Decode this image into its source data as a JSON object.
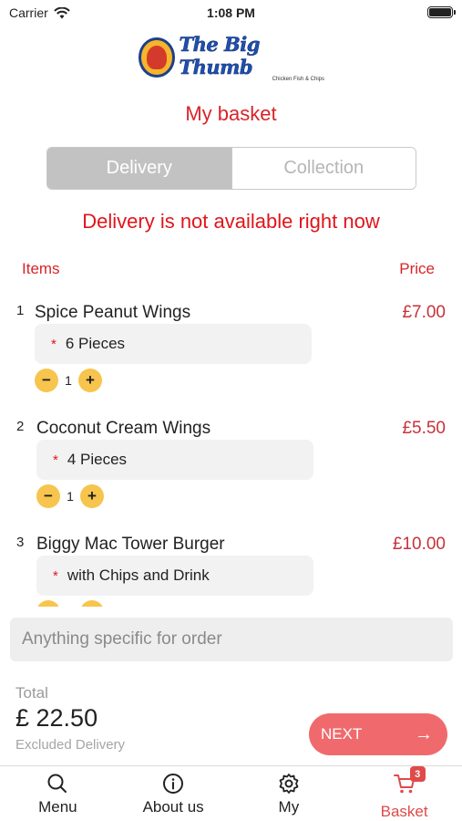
{
  "status_bar": {
    "carrier": "Carrier",
    "time": "1:08 PM"
  },
  "logo": {
    "title": "The Big Thumb",
    "subtitle": "Chicken Fish & Chips"
  },
  "page_title": "My basket",
  "segments": {
    "delivery": "Delivery",
    "collection": "Collection",
    "selected": "Delivery"
  },
  "notice": "Delivery is not available right now",
  "columns": {
    "items": "Items",
    "price": "Price"
  },
  "items": [
    {
      "num": "1",
      "name": "Spice Peanut Wings",
      "price": "£7.00",
      "option": "6 Pieces",
      "qty": "1"
    },
    {
      "num": "2",
      "name": "Coconut Cream Wings",
      "price": "£5.50",
      "option": "4 Pieces",
      "qty": "1"
    },
    {
      "num": "3",
      "name": "Biggy Mac Tower Burger",
      "price": "£10.00",
      "option": "with Chips and Drink",
      "qty": "1"
    }
  ],
  "note": {
    "placeholder": "Anything specific for order",
    "value": ""
  },
  "total": {
    "label": "Total",
    "value": "£ 22.50",
    "sub": "Excluded Delivery"
  },
  "next_button": {
    "label": "NEXT"
  },
  "tabbar": {
    "menu": "Menu",
    "about": "About us",
    "my": "My",
    "basket": "Basket",
    "basket_count": "3",
    "active": "Basket"
  },
  "colors": {
    "accent": "#d8242a",
    "button": "#f06a6d",
    "stepper": "#f7c54d"
  }
}
